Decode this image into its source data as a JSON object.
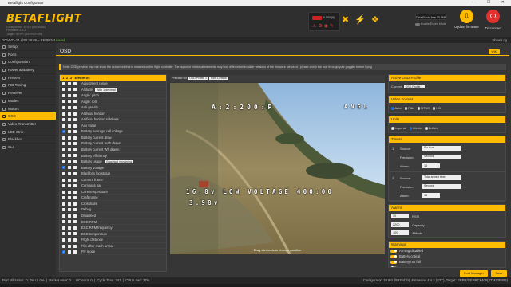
{
  "window": {
    "title": "Betaflight Configurator"
  },
  "header": {
    "logo": "BETAFLIGHT",
    "logo_sub": [
      "Configurator: 10.9.0 (f6976d3b)",
      "Firmware: 4.4.2",
      "Target: GEPR (GEPRCF405)"
    ],
    "battery": "0.00V (0)",
    "data_btn_label": "Data Flash: free 15.9MB",
    "expert_label": "Enable Expert Mode",
    "update_label": "Update firmware",
    "disconnect_label": "Disconnect"
  },
  "log": {
    "time": "2024-03-24 @02:48:06 – EEPROM",
    "saved": "saved",
    "show_log": "Show Log"
  },
  "sidebar": {
    "items": [
      {
        "label": "Setup",
        "active": false
      },
      {
        "label": "Ports",
        "active": false
      },
      {
        "label": "Configuration",
        "active": false
      },
      {
        "label": "Power & Battery",
        "active": false
      },
      {
        "label": "Presets",
        "active": false
      },
      {
        "label": "PID Tuning",
        "active": false
      },
      {
        "label": "Receiver",
        "active": false
      },
      {
        "label": "Modes",
        "active": false
      },
      {
        "label": "Motors",
        "active": false
      },
      {
        "label": "OSD",
        "active": true
      },
      {
        "label": "Video Transmitter",
        "active": false
      },
      {
        "label": "LED Strip",
        "active": false
      },
      {
        "label": "Blackbox",
        "active": false
      },
      {
        "label": "CLI",
        "active": false
      }
    ]
  },
  "osd": {
    "title": "OSD",
    "wiki": "WIKI",
    "note": "Note: OSD preview may not show the actual font that is installed on the flight controller. The layout of individual elements may look different when older versions of the firmware are used - please check the look through your goggles before flying",
    "elements_head": {
      "profiles": [
        "1",
        "2",
        "3"
      ],
      "label": "Elements"
    },
    "elements": [
      {
        "label": "Adjustment range",
        "on": false,
        "variant": ""
      },
      {
        "label": "Altitude",
        "on": false,
        "variant": "With 1 decimal"
      },
      {
        "label": "Angle: pitch",
        "on": false,
        "variant": ""
      },
      {
        "label": "Angle: roll",
        "on": false,
        "variant": ""
      },
      {
        "label": "Anti gravity",
        "on": false,
        "variant": ""
      },
      {
        "label": "Artificial horizon",
        "on": false,
        "variant": ""
      },
      {
        "label": "Artificial horizon sidebars",
        "on": false,
        "variant": ""
      },
      {
        "label": "Aux value",
        "on": false,
        "variant": ""
      },
      {
        "label": "Battery average cell voltage",
        "on": true,
        "variant": ""
      },
      {
        "label": "Battery current draw",
        "on": false,
        "variant": ""
      },
      {
        "label": "Battery current mAh drawn",
        "on": false,
        "variant": ""
      },
      {
        "label": "Battery current Wh drawn",
        "on": false,
        "variant": ""
      },
      {
        "label": "Battery efficiency",
        "on": false,
        "variant": ""
      },
      {
        "label": "Battery usage",
        "on": false,
        "variant": "Graphical remaining"
      },
      {
        "label": "Battery voltage",
        "on": true,
        "variant": ""
      },
      {
        "label": "Blackbox log status",
        "on": false,
        "variant": ""
      },
      {
        "label": "Camera frame",
        "on": false,
        "variant": ""
      },
      {
        "label": "Compass bar",
        "on": false,
        "variant": ""
      },
      {
        "label": "Core temperature",
        "on": false,
        "variant": ""
      },
      {
        "label": "Craft name",
        "on": false,
        "variant": ""
      },
      {
        "label": "Crosshairs",
        "on": false,
        "variant": ""
      },
      {
        "label": "Debug",
        "on": false,
        "variant": ""
      },
      {
        "label": "Disarmed",
        "on": false,
        "variant": ""
      },
      {
        "label": "ESC RPM",
        "on": false,
        "variant": ""
      },
      {
        "label": "ESC RPM frequency",
        "on": false,
        "variant": ""
      },
      {
        "label": "ESC temperature",
        "on": false,
        "variant": ""
      },
      {
        "label": "Flight distance",
        "on": false,
        "variant": ""
      },
      {
        "label": "Flip after crash arrow",
        "on": false,
        "variant": ""
      },
      {
        "label": "Fly mode",
        "on": true,
        "variant": ""
      }
    ],
    "preview": {
      "preview_for": "Preview for",
      "profile": "OSD Profile 1",
      "font": "Font Default",
      "top_text": "A:2:200:P",
      "right_text": "ANGL",
      "voltage_text": "16.8v LOW VOLTAGE 400:00",
      "cell_text": "3.98v",
      "drag_hint": "Drag elements to change position"
    },
    "active_profile": {
      "title": "Active OSD Profile",
      "current_label": "Current:",
      "current": "OSD Profile 1"
    },
    "video_format": {
      "title": "Video Format",
      "options": [
        "Auto",
        "PAL",
        "NTSC",
        "HD"
      ],
      "selected": "Auto"
    },
    "units": {
      "title": "Units",
      "options": [
        "Imperial",
        "Metric",
        "British"
      ],
      "selected": "Metric"
    },
    "timers": {
      "title": "Timers",
      "items": [
        {
          "index": "1",
          "source_label": "Source:",
          "source": "On time",
          "precision_label": "Precision:",
          "precision": "Second",
          "alarm_label": "Alarm:",
          "alarm": "10"
        },
        {
          "index": "2",
          "source_label": "Source:",
          "source": "Total armed time",
          "precision_label": "Precision:",
          "precision": "Second",
          "alarm_label": "Alarm:",
          "alarm": "10"
        }
      ]
    },
    "alarms": {
      "title": "Alarms",
      "items": [
        {
          "value": "30",
          "label": "RSSI"
        },
        {
          "value": "2200",
          "label": "Capacity"
        },
        {
          "value": "100",
          "label": "Altitude"
        }
      ]
    },
    "warnings": {
      "title": "Warnings",
      "items": [
        {
          "label": "Arming disabled",
          "on": true
        },
        {
          "label": "Battery critical",
          "on": true
        },
        {
          "label": "Battery not full",
          "on": true
        },
        {
          "label": "",
          "on": false
        }
      ]
    },
    "buttons": {
      "font_manager": "Font Manager",
      "save": "Save"
    }
  },
  "status": {
    "port_util": "Port utilization: D: 0% U: 0%",
    "packet_error": "Packet error: 0",
    "i2c_error": "I2C error: 0",
    "cycle_time": "Cycle Time: 247",
    "cpu_load": "CPU Load: 27%",
    "version": "Configurator: 10.9.0 (f6976d3b), Firmware: 4.4.2 (STT), Target: GEPR/GEPRCF405(STM32F405)"
  },
  "colors": {
    "accent": "#ffbb00",
    "bg": "#363636",
    "panel": "#3c3c3c"
  }
}
